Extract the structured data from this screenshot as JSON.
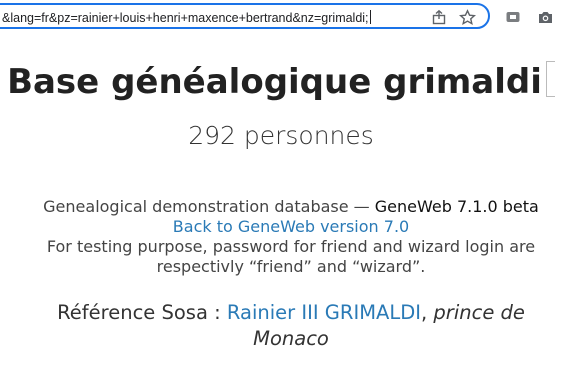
{
  "browser": {
    "url": "&lang=fr&pz=rainier+louis+henri+maxence+bertrand&nz=grimaldi;",
    "icons": [
      "share-icon",
      "star-icon",
      "extension-icon",
      "camera-icon"
    ]
  },
  "page": {
    "title": "Base généalogique grimaldi",
    "count": "292 personnes",
    "info_line1_prefix": "Genealogical demonstration database — ",
    "info_line1_version": "GeneWeb 7.1.0 beta",
    "back_link": "Back to GeneWeb version 7.0",
    "info_line3": "For testing purpose, password for friend and wizard login are respectivly “friend” and “wizard”.",
    "sosa_label": "Référence Sosa : ",
    "sosa_person": "Rainier III GRIMALDI",
    "sosa_sep": ", ",
    "sosa_title": "prince de Monaco"
  },
  "colors": {
    "link": "#2a7ab6",
    "omnibox_border": "#1a73e8"
  }
}
